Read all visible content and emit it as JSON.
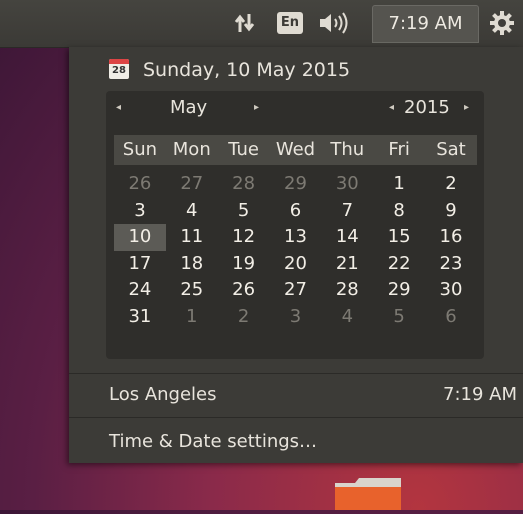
{
  "top_panel": {
    "keyboard_layout": "En",
    "clock": "7:19 AM",
    "icons": [
      "network-updown-icon",
      "volume-icon",
      "system-gear-icon"
    ]
  },
  "datetime_menu": {
    "calendar_icon_day": "28",
    "full_date": "Sunday, 10 May 2015",
    "calendar": {
      "month": "May",
      "year": "2015",
      "weekdays": [
        "Sun",
        "Mon",
        "Tue",
        "Wed",
        "Thu",
        "Fri",
        "Sat"
      ],
      "weeks": [
        [
          {
            "d": "26",
            "o": true
          },
          {
            "d": "27",
            "o": true
          },
          {
            "d": "28",
            "o": true
          },
          {
            "d": "29",
            "o": true
          },
          {
            "d": "30",
            "o": true
          },
          {
            "d": "1"
          },
          {
            "d": "2"
          }
        ],
        [
          {
            "d": "3"
          },
          {
            "d": "4"
          },
          {
            "d": "5"
          },
          {
            "d": "6"
          },
          {
            "d": "7"
          },
          {
            "d": "8"
          },
          {
            "d": "9"
          }
        ],
        [
          {
            "d": "10",
            "t": true
          },
          {
            "d": "11"
          },
          {
            "d": "12"
          },
          {
            "d": "13"
          },
          {
            "d": "14"
          },
          {
            "d": "15"
          },
          {
            "d": "16"
          }
        ],
        [
          {
            "d": "17"
          },
          {
            "d": "18"
          },
          {
            "d": "19"
          },
          {
            "d": "20"
          },
          {
            "d": "21"
          },
          {
            "d": "22"
          },
          {
            "d": "23"
          }
        ],
        [
          {
            "d": "24"
          },
          {
            "d": "25"
          },
          {
            "d": "26"
          },
          {
            "d": "27"
          },
          {
            "d": "28"
          },
          {
            "d": "29"
          },
          {
            "d": "30"
          }
        ],
        [
          {
            "d": "31"
          },
          {
            "d": "1",
            "o": true
          },
          {
            "d": "2",
            "o": true
          },
          {
            "d": "3",
            "o": true
          },
          {
            "d": "4",
            "o": true
          },
          {
            "d": "5",
            "o": true
          },
          {
            "d": "6",
            "o": true
          }
        ]
      ]
    },
    "location": {
      "name": "Los Angeles",
      "time": "7:19 AM"
    },
    "settings_label": "Time & Date settings…"
  },
  "colors": {
    "panel": "#3c3b37",
    "calendar_bg": "#2f2e2b",
    "today_highlight": "#5c5b56"
  }
}
